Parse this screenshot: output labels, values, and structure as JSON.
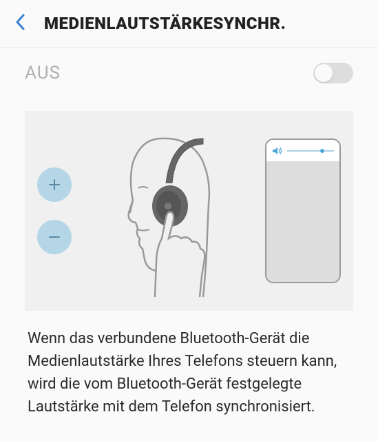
{
  "header": {
    "title": "MEDIENLAUTSTÄRKESYNCHR."
  },
  "toggle": {
    "label": "AUS",
    "state": "off"
  },
  "illustration": {
    "plus_icon": "plus",
    "minus_icon": "minus",
    "volume_icon": "speaker"
  },
  "description": "Wenn das verbundene Bluetooth-Gerät die Medienlautstärke Ihres Telefons steuern kann, wird die vom Bluetooth-Gerät festgelegte Lautstärke mit dem Telefon synchronisiert."
}
